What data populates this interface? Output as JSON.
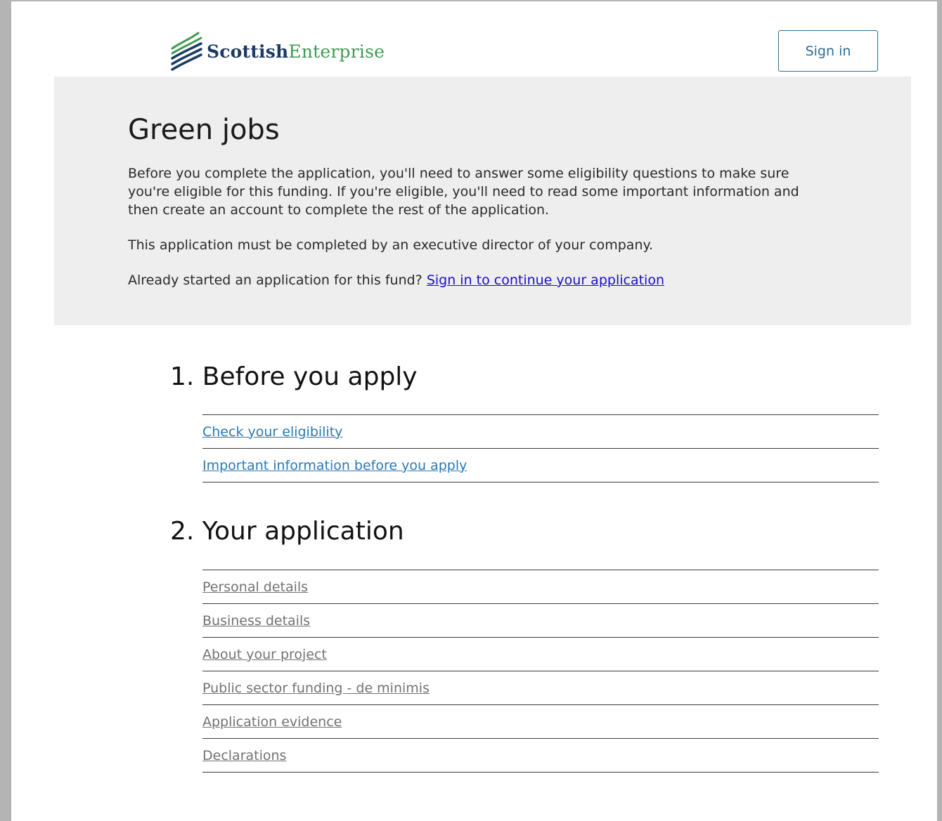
{
  "header": {
    "logo": {
      "word1": "Scottish",
      "word2": "Enterprise",
      "icon": "wave-stripes-icon"
    },
    "sign_in_label": "Sign in"
  },
  "hero": {
    "title": "Green jobs",
    "paragraph1": "Before you complete the application, you'll need to answer some eligibility questions to make sure you're eligible for this funding. If you're eligible, you'll need to read some important information and then create an account to complete the rest of the application.",
    "paragraph2": "This application must be completed by an executive director of your company.",
    "already_started_text": "Already started an application for this fund?",
    "continue_link": "Sign in to continue your application"
  },
  "sections": [
    {
      "title": "1.  Before you apply",
      "items": [
        "Check your eligibility",
        "Important information before you apply"
      ]
    },
    {
      "title": "2. Your application",
      "items": [
        "Personal details",
        "Business details",
        "About your project",
        "Public sector funding - de minimis",
        "Application evidence",
        "Declarations "
      ]
    }
  ],
  "colors": {
    "brand_navy": "#1b3a67",
    "brand_green": "#3f9a52",
    "active_link": "#2a79b4",
    "disabled_link": "#727272",
    "hero_bg": "#eeeeee",
    "continue_link": "#1a0dcc"
  }
}
